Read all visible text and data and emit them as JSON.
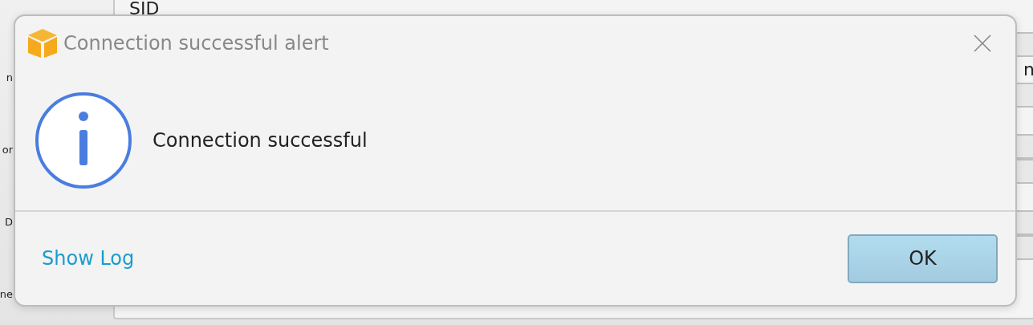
{
  "background": {
    "header": "SID",
    "left_labels": [
      "n",
      "or",
      "D",
      "ne"
    ],
    "right_text": "n"
  },
  "dialog": {
    "title": "Connection successful alert",
    "message": "Connection successful",
    "link": "Show Log",
    "button": "OK"
  }
}
